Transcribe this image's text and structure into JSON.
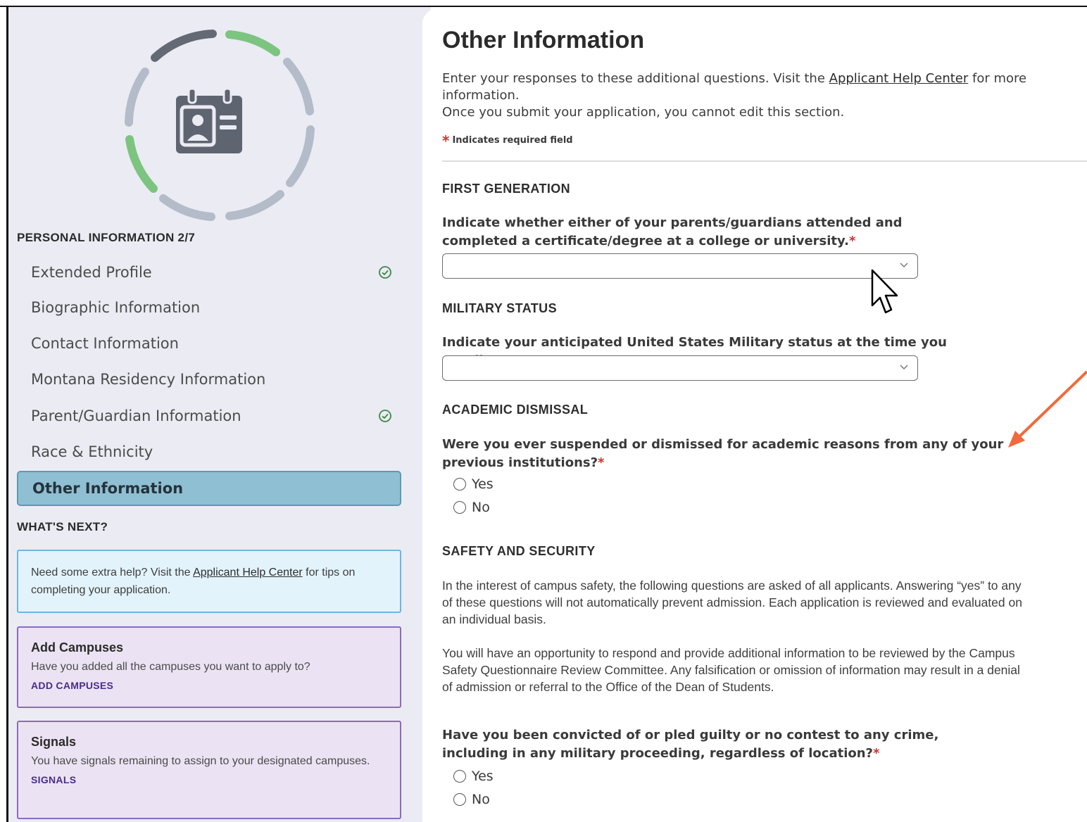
{
  "sidebar": {
    "section_title": "PERSONAL INFORMATION 2/7",
    "items": [
      {
        "label": "Extended Profile",
        "completed": true
      },
      {
        "label": "Biographic Information",
        "completed": false
      },
      {
        "label": "Contact Information",
        "completed": false
      },
      {
        "label": "Montana Residency Information",
        "completed": false
      },
      {
        "label": "Parent/Guardian Information",
        "completed": true
      },
      {
        "label": "Race & Ethnicity",
        "completed": false
      },
      {
        "label": "Other Information",
        "completed": false,
        "active": true
      }
    ],
    "whats_next_title": "WHAT'S NEXT?",
    "help_card": {
      "text_before": "Need some extra help? Visit the ",
      "link": "Applicant Help Center",
      "text_after": " for tips on completing your application."
    },
    "campuses_card": {
      "title": "Add Campuses",
      "text": "Have you added all the campuses you want to apply to?",
      "link": "ADD CAMPUSES"
    },
    "signals_card": {
      "title": "Signals",
      "text": "You have signals remaining to assign to your designated campuses.",
      "link": "SIGNALS"
    },
    "progress_icon": "id-card-icon"
  },
  "main": {
    "title": "Other Information",
    "intro_before": "Enter your responses to these additional questions. Visit the ",
    "intro_link": "Applicant Help Center",
    "intro_after": " for more information.",
    "edit_note": "Once you submit your application, you cannot edit this section.",
    "required_note": "Indicates required field",
    "first_generation": {
      "heading": "FIRST GENERATION",
      "question": "Indicate whether either of your parents/guardians attended and completed a certificate/degree at a college or university.",
      "value": ""
    },
    "military": {
      "heading": "MILITARY STATUS",
      "question": "Indicate your anticipated United States Military status at the time you enroll:",
      "value": ""
    },
    "academic_dismissal": {
      "heading": "ACADEMIC DISMISSAL",
      "question": "Were you ever suspended or dismissed for academic reasons from any of your previous institutions?",
      "options": [
        "Yes",
        "No"
      ]
    },
    "safety": {
      "heading": "SAFETY AND SECURITY",
      "paragraph1": "In the interest of campus safety, the following questions are asked of all applicants. Answering “yes” to any of these questions will not automatically prevent admission. Each application is reviewed and evaluated on an individual basis.",
      "paragraph2": "You will have an opportunity to respond and provide additional information to be reviewed by the Campus Safety Questionnaire Review Committee. Any falsification or omission of information may result in a denial of admission or referral to the Office of the Dean of Students.",
      "question": "Have you been convicted of or pled guilty or no contest to any crime, including in any military proceeding, regardless of location?",
      "options": [
        "Yes",
        "No"
      ]
    }
  },
  "colors": {
    "active_nav_bg": "#8fbfd3",
    "required_star": "#d0312d",
    "progress_complete": "#7cc47f",
    "progress_dark": "#636a74",
    "progress_pending": "#b3bcc8",
    "annotation_arrow": "#f26a3b",
    "card_purple_border": "#8c6ac0",
    "card_help_border": "#6fb6db"
  }
}
